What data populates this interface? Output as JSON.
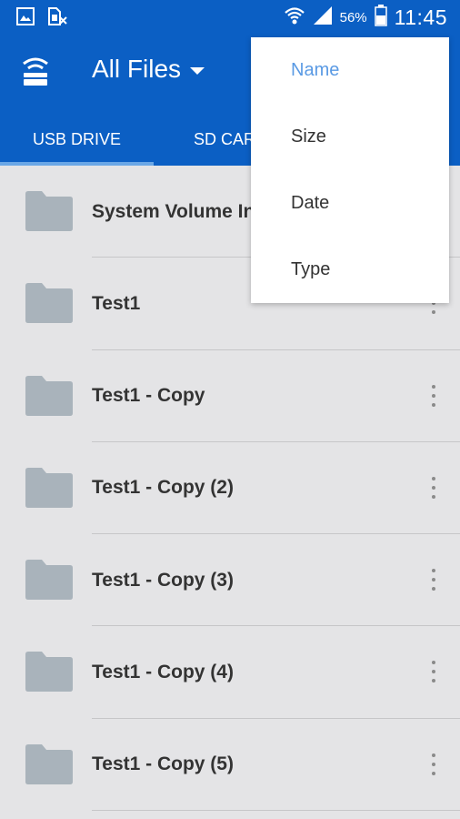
{
  "status_bar": {
    "battery_pct": "56%",
    "time": "11:45",
    "icons": [
      "image-icon",
      "sim-off-icon",
      "wifi-icon",
      "signal-icon",
      "battery-icon"
    ]
  },
  "app_bar": {
    "title": "All Files",
    "icon": "drive-wifi-icon"
  },
  "tabs": [
    {
      "label": "USB DRIVE",
      "active": true
    },
    {
      "label": "SD CARD",
      "active": false
    }
  ],
  "files": [
    {
      "name": "System Volume Information"
    },
    {
      "name": "Test1"
    },
    {
      "name": "Test1 - Copy"
    },
    {
      "name": "Test1 - Copy (2)"
    },
    {
      "name": "Test1 - Copy (3)"
    },
    {
      "name": "Test1 - Copy (4)"
    },
    {
      "name": "Test1 - Copy (5)"
    }
  ],
  "sort_menu": {
    "items": [
      {
        "label": "Name",
        "selected": true
      },
      {
        "label": "Size",
        "selected": false
      },
      {
        "label": "Date",
        "selected": false
      },
      {
        "label": "Type",
        "selected": false
      }
    ]
  },
  "colors": {
    "primary": "#0b5fc4",
    "accent": "#5a9ae4",
    "folder": "#a9b3bb",
    "background": "#e4e4e6"
  }
}
